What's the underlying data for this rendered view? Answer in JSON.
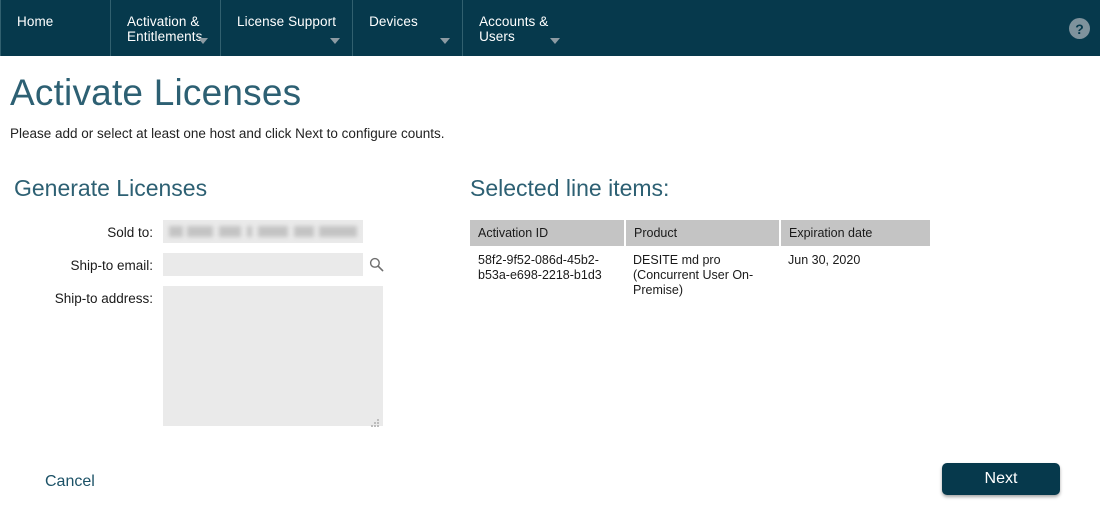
{
  "nav": {
    "items": [
      {
        "label": "Home",
        "has_caret": false
      },
      {
        "label": "Activation &\nEntitlements",
        "has_caret": true
      },
      {
        "label": "License Support",
        "has_caret": true
      },
      {
        "label": "Devices",
        "has_caret": true
      },
      {
        "label": "Accounts &\nUsers",
        "has_caret": true
      }
    ],
    "help_icon": "?",
    "background_color": "#06394c"
  },
  "page": {
    "title": "Activate Licenses",
    "subtitle": "Please add or select at least one host and click Next to configure counts.",
    "title_color": "#2d6073"
  },
  "generate_licenses": {
    "section_title": "Generate Licenses",
    "sold_to": {
      "label": "Sold to:",
      "value": "",
      "redacted": true
    },
    "ship_to_email": {
      "label": "Ship-to email:",
      "value": "",
      "placeholder": "",
      "search_icon": "search-icon"
    },
    "ship_to_address": {
      "label": "Ship-to address:",
      "value": "",
      "placeholder": ""
    }
  },
  "selected_line_items": {
    "section_title": "Selected line items:",
    "columns": [
      "Activation ID",
      "Product",
      "Expiration date"
    ],
    "rows": [
      {
        "activation_id": "58f2-9f52-086d-45b2-b53a-e698-2218-b1d3",
        "product": "DESITE md pro (Concurrent User On-Premise)",
        "expiration_date": "Jun 30, 2020"
      }
    ]
  },
  "footer": {
    "cancel_label": "Cancel",
    "next_label": "Next"
  }
}
